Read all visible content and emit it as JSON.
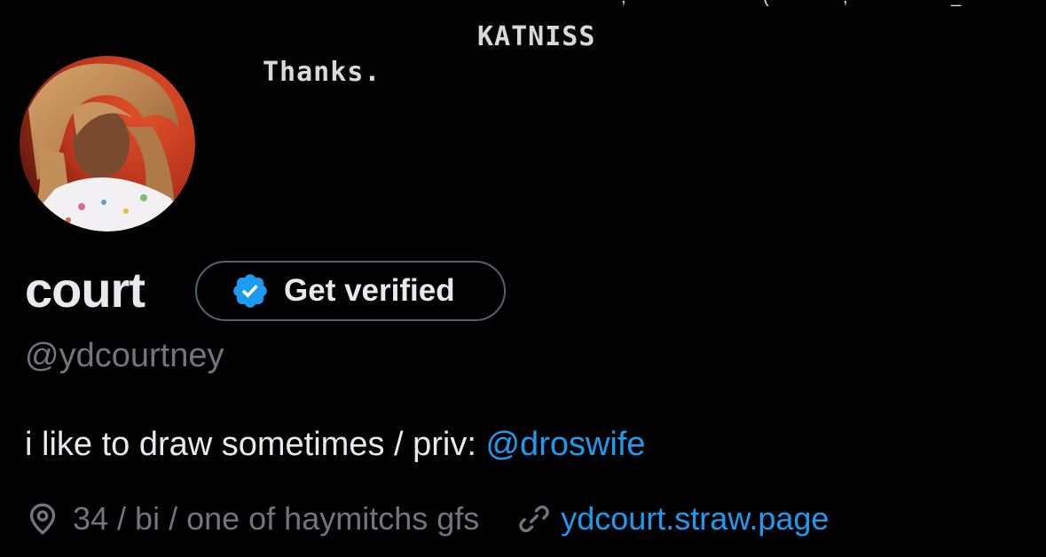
{
  "banner": {
    "script_name": "KATNISS",
    "script_line": "Thanks."
  },
  "profile": {
    "display_name": "court",
    "get_verified_label": "Get verified",
    "handle": "@ydcourtney",
    "bio_text": "i like to draw sometimes / priv: ",
    "bio_mention": "@droswife",
    "location": "34 / bi / one of haymitchs gfs",
    "website": "ydcourt.straw.page"
  },
  "icons": {
    "verified": "verified-badge-icon",
    "location": "location-pin-icon",
    "link": "link-icon"
  },
  "colors": {
    "background": "#000000",
    "primary_text": "#e7e9ea",
    "secondary_text": "#71767b",
    "accent": "#1d9bf0",
    "button_border": "#536471"
  }
}
